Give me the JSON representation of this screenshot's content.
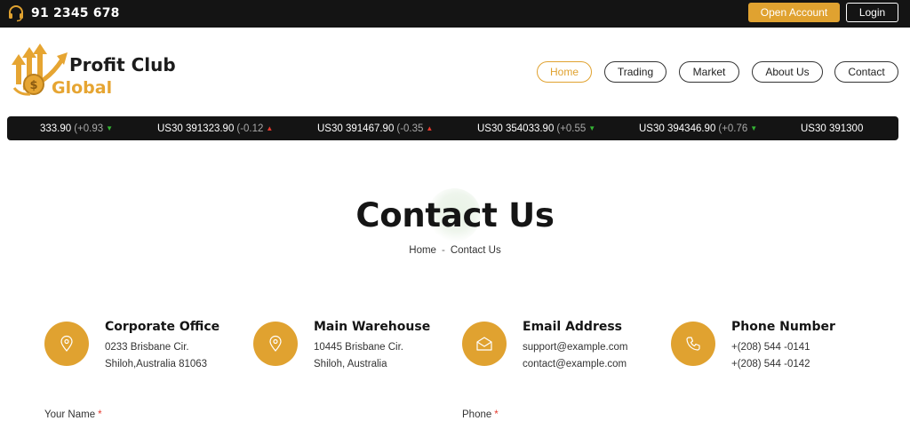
{
  "topbar": {
    "phone": "91 2345 678",
    "open_account": "Open Account",
    "login": "Login"
  },
  "logo": {
    "line1": "Profit Club",
    "line2": "Global"
  },
  "nav": [
    {
      "label": "Home"
    },
    {
      "label": "Trading"
    },
    {
      "label": "Market"
    },
    {
      "label": "About Us"
    },
    {
      "label": "Contact"
    }
  ],
  "ticker": {
    "lead": {
      "value": "333.90",
      "change": "(+0.93"
    },
    "items": [
      {
        "symbol": "US30",
        "value": "391323.90",
        "change": "(-0.12",
        "direction": "up"
      },
      {
        "symbol": "US30",
        "value": "391467.90",
        "change": "(-0.35",
        "direction": "up"
      },
      {
        "symbol": "US30",
        "value": "354033.90",
        "change": "(+0.55",
        "direction": "down"
      },
      {
        "symbol": "US30",
        "value": "394346.90",
        "change": "(+0.76",
        "direction": "down"
      }
    ],
    "tail": "US30 391300"
  },
  "hero": {
    "title": "Contact Us",
    "breadcrumb_home": "Home",
    "breadcrumb_sep": "-",
    "breadcrumb_current": "Contact Us"
  },
  "info": [
    {
      "icon": "location-pin-icon",
      "heading": "Corporate Office",
      "line1": "0233 Brisbane Cir.",
      "line2": "Shiloh,Australia 81063"
    },
    {
      "icon": "location-pin-icon",
      "heading": "Main Warehouse",
      "line1": "10445 Brisbane Cir.",
      "line2": "Shiloh, Australia"
    },
    {
      "icon": "envelope-icon",
      "heading": "Email Address",
      "line1": "support@example.com",
      "line2": "contact@example.com"
    },
    {
      "icon": "phone-icon",
      "heading": "Phone Number",
      "line1": "+(208) 544 -0141",
      "line2": "+(208) 544 -0142"
    }
  ],
  "form": {
    "name_label": "Your Name",
    "phone_label": "Phone",
    "required_mark": "*"
  },
  "colors": {
    "accent": "#e0a230",
    "dark": "#141414",
    "ticker_up": "#e53a2e",
    "ticker_down": "#35b535"
  }
}
